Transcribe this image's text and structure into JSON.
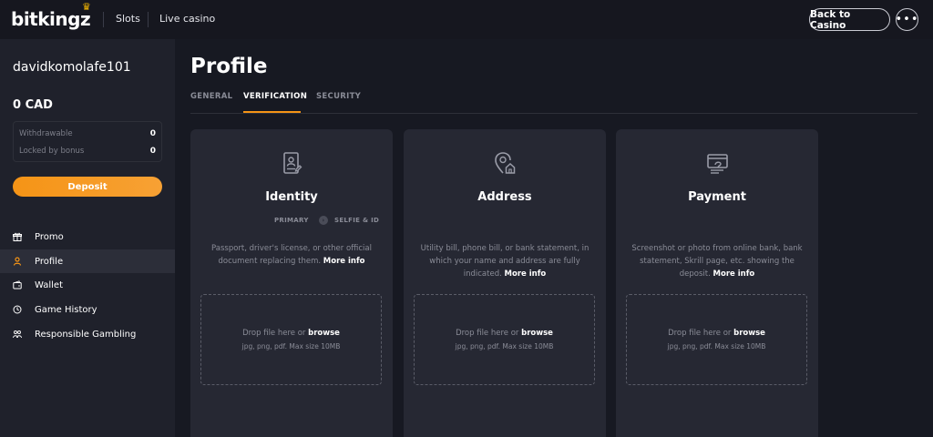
{
  "header": {
    "logo_text": "bitkingz",
    "nav": [
      {
        "label": "Slots"
      },
      {
        "label": "Live casino"
      }
    ],
    "back_button_label": "Back to Casino",
    "more_button_label": "•••"
  },
  "sidebar": {
    "username": "davidkomolafe101",
    "balance": "0 CAD",
    "withdrawable_label": "Withdrawable",
    "withdrawable_value": "0",
    "locked_label": "Locked by bonus",
    "locked_value": "0",
    "deposit_label": "Deposit",
    "menu": [
      {
        "label": "Promo",
        "icon": "gift-icon",
        "active": false
      },
      {
        "label": "Profile",
        "icon": "user-icon",
        "active": true
      },
      {
        "label": "Wallet",
        "icon": "wallet-icon",
        "active": false
      },
      {
        "label": "Game History",
        "icon": "clock-icon",
        "active": false
      },
      {
        "label": "Responsible Gambling",
        "icon": "people-icon",
        "active": false
      }
    ]
  },
  "main": {
    "title": "Profile",
    "tabs": [
      {
        "label": "GENERAL",
        "active": false
      },
      {
        "label": "VERIFICATION",
        "active": true
      },
      {
        "label": "SECURITY",
        "active": false
      }
    ],
    "cards": [
      {
        "title": "Identity",
        "icon": "id-document-icon",
        "step_primary": "PRIMARY",
        "step_badge": "›",
        "step_secondary": "SELFIE & ID",
        "description": "Passport, driver's license, or other official document replacing them.",
        "more_info": "More info",
        "drop_text": "Drop file here or",
        "browse": "browse",
        "hint": "jpg, png, pdf. Max size 10MB"
      },
      {
        "title": "Address",
        "icon": "location-home-icon",
        "description": "Utility bill, phone bill, or bank statement, in which your name and address are fully indicated.",
        "more_info": "More info",
        "drop_text": "Drop file here or",
        "browse": "browse",
        "hint": "jpg, png, pdf. Max size 10MB"
      },
      {
        "title": "Payment",
        "icon": "payment-card-icon",
        "description": "Screenshot or photo from online bank, bank statement, Skrill page, etc. showing the deposit.",
        "more_info": "More info",
        "drop_text": "Drop file here or",
        "browse": "browse",
        "hint": "jpg, png, pdf. Max size 10MB"
      }
    ]
  },
  "colors": {
    "accent": "#f59416",
    "background": "#171922",
    "sidebar": "#1f212b",
    "card": "#262833"
  }
}
